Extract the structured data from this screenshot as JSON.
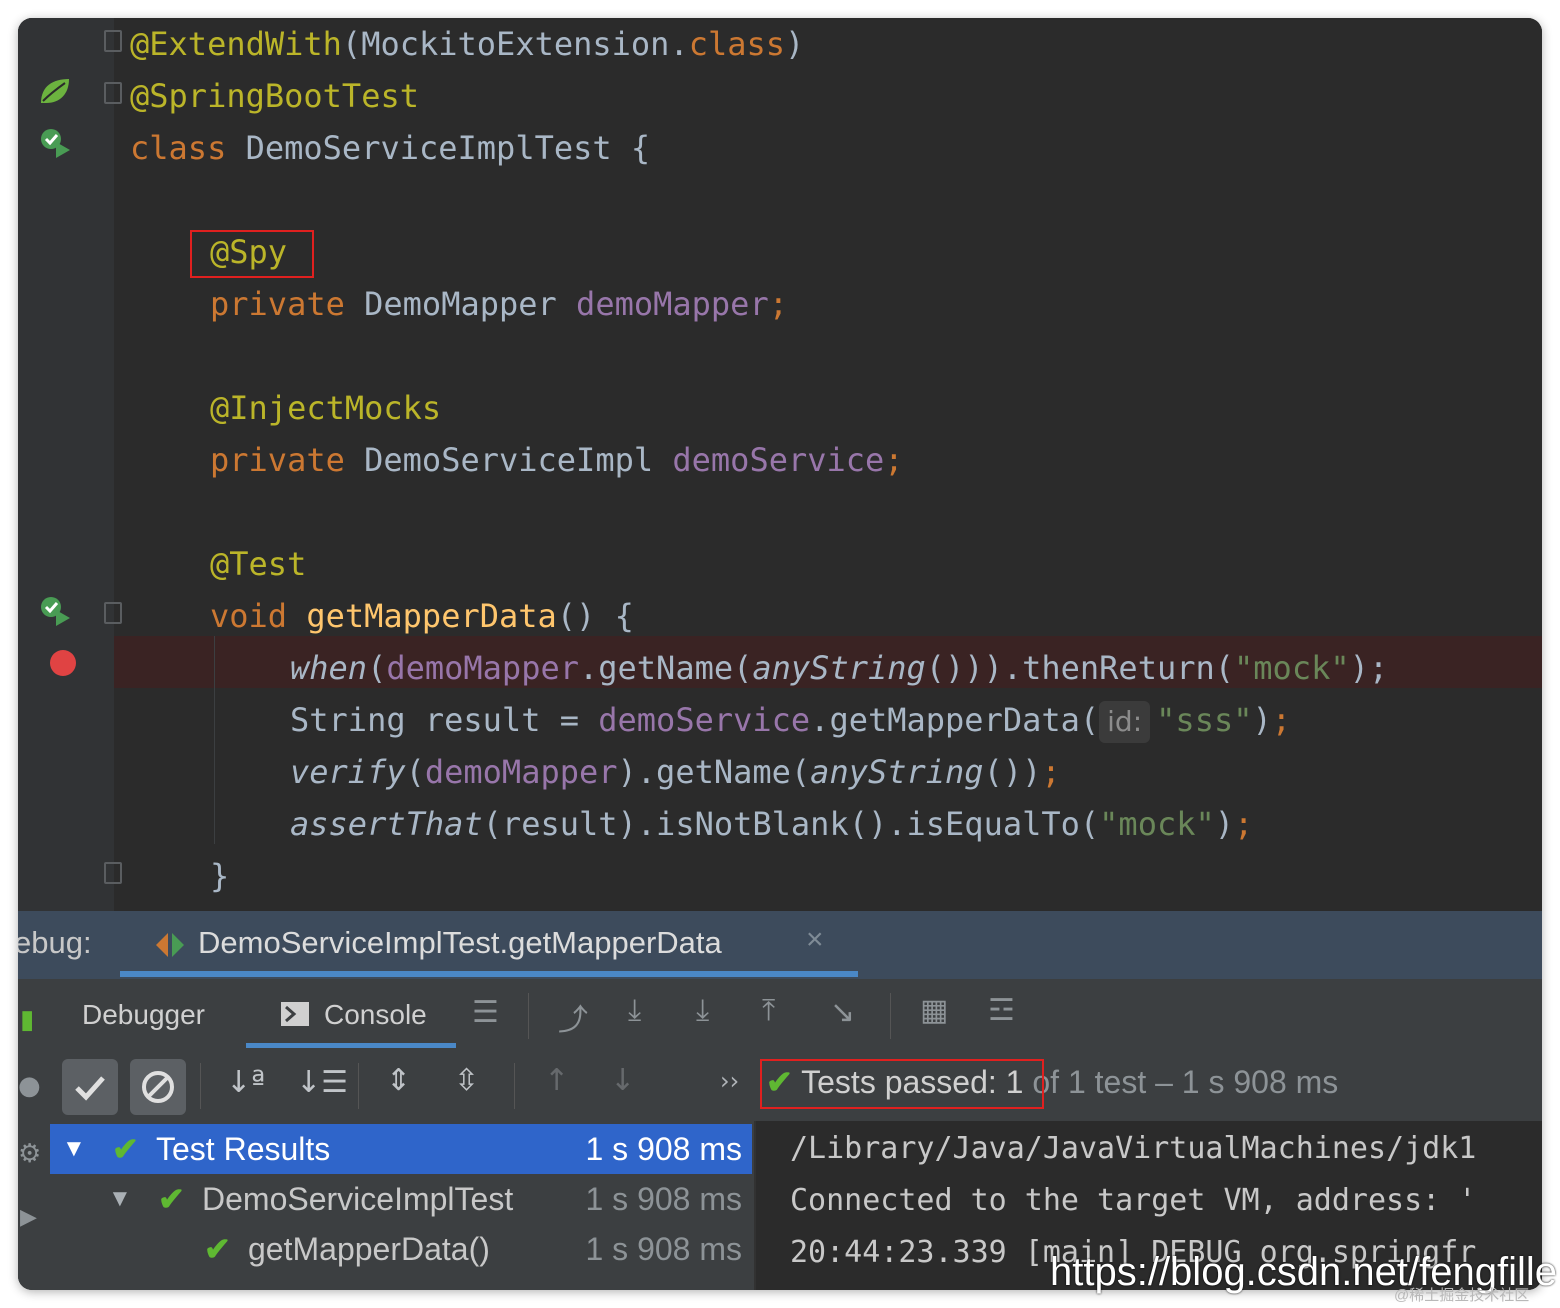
{
  "editor": {
    "lines": [
      {
        "id": "l1",
        "parts": [
          {
            "t": "@ExtendWith",
            "c": "ann"
          },
          {
            "t": "(MockitoExtension."
          },
          {
            "t": "class",
            "c": "kw"
          },
          {
            "t": ")"
          }
        ]
      },
      {
        "id": "l2",
        "parts": [
          {
            "t": "@SpringBootTest",
            "c": "ann"
          }
        ]
      },
      {
        "id": "l3",
        "parts": [
          {
            "t": "class ",
            "c": "kw"
          },
          {
            "t": "DemoServiceImplTest {"
          }
        ]
      },
      {
        "id": "l4",
        "parts": [
          {
            "t": "@Spy",
            "c": "ann"
          }
        ]
      },
      {
        "id": "l5",
        "parts": [
          {
            "t": "private ",
            "c": "kw"
          },
          {
            "t": "DemoMapper "
          },
          {
            "t": "demoMapper",
            "c": "fld"
          },
          {
            "t": ";",
            "c": "kw"
          }
        ]
      },
      {
        "id": "l6",
        "parts": [
          {
            "t": "@InjectMocks",
            "c": "ann"
          }
        ]
      },
      {
        "id": "l7",
        "parts": [
          {
            "t": "private ",
            "c": "kw"
          },
          {
            "t": "DemoServiceImpl "
          },
          {
            "t": "demoService",
            "c": "fld"
          },
          {
            "t": ";",
            "c": "kw"
          }
        ]
      },
      {
        "id": "l8",
        "parts": [
          {
            "t": "@Test",
            "c": "ann"
          }
        ]
      },
      {
        "id": "l9",
        "parts": [
          {
            "t": "void ",
            "c": "kw"
          },
          {
            "t": "getMapperData",
            "c": "fn"
          },
          {
            "t": "() {"
          }
        ]
      },
      {
        "id": "l10",
        "parts": [
          {
            "t": "when",
            "c": "ital"
          },
          {
            "t": "("
          },
          {
            "t": "demoMapper",
            "c": "fld"
          },
          {
            "t": ".getName("
          },
          {
            "t": "anyString",
            "c": "ital"
          },
          {
            "t": "())).thenReturn("
          },
          {
            "t": "\"mock\"",
            "c": "str"
          },
          {
            "t": ");"
          },
          {
            "t": "",
            "c": "kw"
          }
        ]
      },
      {
        "id": "l11",
        "parts": [
          {
            "t": "String result = "
          },
          {
            "t": "demoService",
            "c": "fld"
          },
          {
            "t": ".getMapperData("
          },
          {
            "t": "id:",
            "c": "hint"
          },
          {
            "t": "\"sss\"",
            "c": "str"
          },
          {
            "t": ")"
          },
          {
            "t": ";",
            "c": "kw"
          }
        ]
      },
      {
        "id": "l12",
        "parts": [
          {
            "t": "verify",
            "c": "ital"
          },
          {
            "t": "("
          },
          {
            "t": "demoMapper",
            "c": "fld"
          },
          {
            "t": ").getName("
          },
          {
            "t": "anyString",
            "c": "ital"
          },
          {
            "t": "())"
          },
          {
            "t": ";",
            "c": "kw"
          }
        ]
      },
      {
        "id": "l13",
        "parts": [
          {
            "t": "assertThat",
            "c": "ital"
          },
          {
            "t": "(result).isNotBlank().isEqualTo("
          },
          {
            "t": "\"mock\"",
            "c": "str"
          },
          {
            "t": ")"
          },
          {
            "t": ";",
            "c": "kw"
          }
        ]
      },
      {
        "id": "l14",
        "parts": [
          {
            "t": "}"
          }
        ]
      }
    ]
  },
  "debug": {
    "label": "ebug:",
    "session_title": "DemoServiceImplTest.getMapperData",
    "close_glyph": "×",
    "tabs": [
      {
        "label": "Debugger"
      },
      {
        "label": "Console"
      }
    ],
    "status": {
      "passed_label": "Tests passed:",
      "count_text": "1",
      "detail_text": " of 1 test – 1 s 908 ms"
    },
    "tree": [
      {
        "label": "Test Results",
        "time": "1 s 908 ms"
      },
      {
        "label": "DemoServiceImplTest",
        "time": "1 s 908 ms"
      },
      {
        "label": "getMapperData()",
        "time": "1 s 908 ms"
      }
    ],
    "console_lines": [
      "/Library/Java/JavaVirtualMachines/jdk1",
      "Connected to the target VM, address: '",
      "20:44:23.339 [main] DEBUG org.springfr"
    ]
  },
  "watermark": {
    "url": "https://blog.csdn.net/fengfille",
    "sub": "@稀土掘金技术社区"
  },
  "colors": {
    "background": "#2b2b2b",
    "annotation": "#bbb529",
    "keyword": "#cc7832",
    "field": "#9876aa",
    "string": "#6a8759",
    "method": "#ffc66d",
    "selection": "#2f65ca",
    "breakpoint": "#e04343",
    "pass_check": "#5fb832",
    "highlight_box": "#e0201f"
  }
}
